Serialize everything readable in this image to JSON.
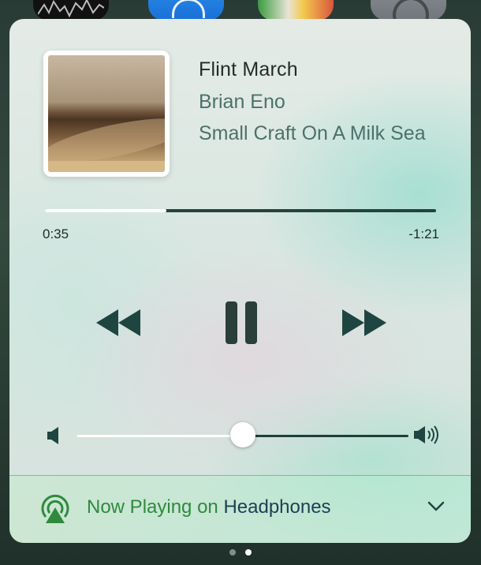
{
  "now_playing": {
    "title": "Flint March",
    "artist": "Brian Eno",
    "album": "Small Craft On A Milk Sea"
  },
  "playback": {
    "elapsed": "0:35",
    "remaining": "-1:21",
    "progress_fraction": 0.31
  },
  "volume": {
    "level_fraction": 0.5
  },
  "output": {
    "prefix": "Now Playing on ",
    "device": "Headphones"
  },
  "page_indicator": {
    "count": 2,
    "current": 2
  },
  "background_icons": [
    "stocks-icon",
    "app-store-icon",
    "maps-icon",
    "settings-icon"
  ],
  "colors": {
    "accent_green": "#2f8a3d",
    "control_dark": "#1f4540"
  }
}
